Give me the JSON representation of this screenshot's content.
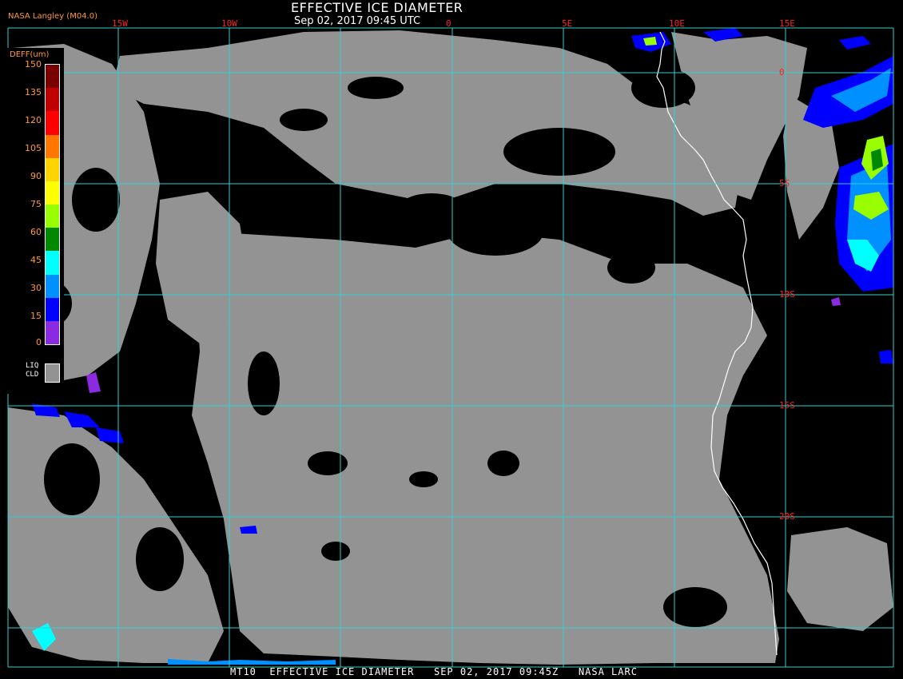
{
  "header": {
    "title": "EFFECTIVE ICE DIAMETER",
    "subtitle": "Sep 02, 2017 09:45 UTC",
    "producer": "NASA Langley (M04.0)"
  },
  "footer": {
    "caption": "MT10  EFFECTIVE ICE DIAMETER   SEP 02, 2017 09:45Z   NASA LARC"
  },
  "legend": {
    "title": "DEFF(um)",
    "ticks": [
      "150",
      "135",
      "120",
      "105",
      "90",
      "75",
      "60",
      "45",
      "30",
      "15",
      "0"
    ],
    "colors": [
      "#7a0000",
      "#c00000",
      "#ff0000",
      "#ff7700",
      "#ffd400",
      "#ffff00",
      "#99ff00",
      "#008800",
      "#00ffff",
      "#0090ff",
      "#0000ff",
      "#8a2be2"
    ],
    "liquid_label": "LIQ\nCLD",
    "liquid_color": "#939393"
  },
  "grid": {
    "longitudes": [
      "15W",
      "10W",
      "0",
      "5E",
      "10E",
      "15E"
    ],
    "latitudes": [
      "0",
      "5S",
      "10S",
      "15S",
      "20S"
    ],
    "line_color": "#30d0d0"
  },
  "colors": {
    "background": "#000000",
    "cloud_gray": "#939393",
    "coastline": "#ffffff",
    "label_red": "#ff2222",
    "label_orange": "#ff9933"
  }
}
